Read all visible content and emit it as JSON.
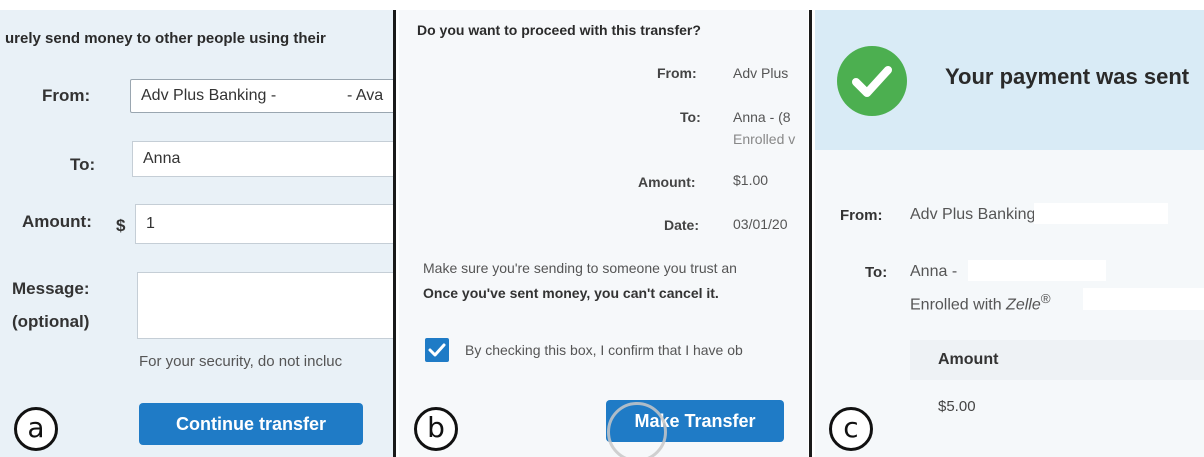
{
  "panel_a": {
    "badge": "a",
    "intro": "urely send money to other people using their",
    "from_label": "From:",
    "from_value_left": "Adv Plus Banking -",
    "from_value_right": "- Ava",
    "to_label": "To:",
    "to_value": "Anna",
    "amount_label": "Amount:",
    "currency": "$",
    "amount_value": "1",
    "message_label_1": "Message:",
    "message_label_2": "(optional)",
    "help_text": "For your security, do not incluc",
    "continue_button": "Continue transfer"
  },
  "panel_b": {
    "badge": "b",
    "question": "Do you want to proceed with this transfer?",
    "from_label": "From:",
    "from_value": "Adv Plus",
    "to_label": "To:",
    "to_value": "Anna - (8",
    "to_enrolled": "Enrolled v",
    "amount_label": "Amount:",
    "amount_value": "$1.00",
    "date_label": "Date:",
    "date_value": "03/01/20",
    "warning": "Make sure you're sending to someone you trust an",
    "warning_bold": "Once you've sent money, you can't cancel it.",
    "consent": "By checking this box, I confirm that I have ob",
    "consent_checked": true,
    "make_transfer_button": "Make Transfer"
  },
  "panel_c": {
    "badge": "c",
    "title": "Your payment was sent",
    "from_label": "From:",
    "from_value": "Adv Plus Banking",
    "to_label": "To:",
    "to_value": "Anna -",
    "enrolled_prefix": "Enrolled with ",
    "enrolled_brand": "Zelle",
    "enrolled_mark": "®",
    "amount_header": "Amount",
    "amount_value": "$5.00"
  },
  "colors": {
    "primary_blue": "#1f7bc6",
    "success_green": "#4caf50",
    "header_blue": "#d9ebf6"
  }
}
